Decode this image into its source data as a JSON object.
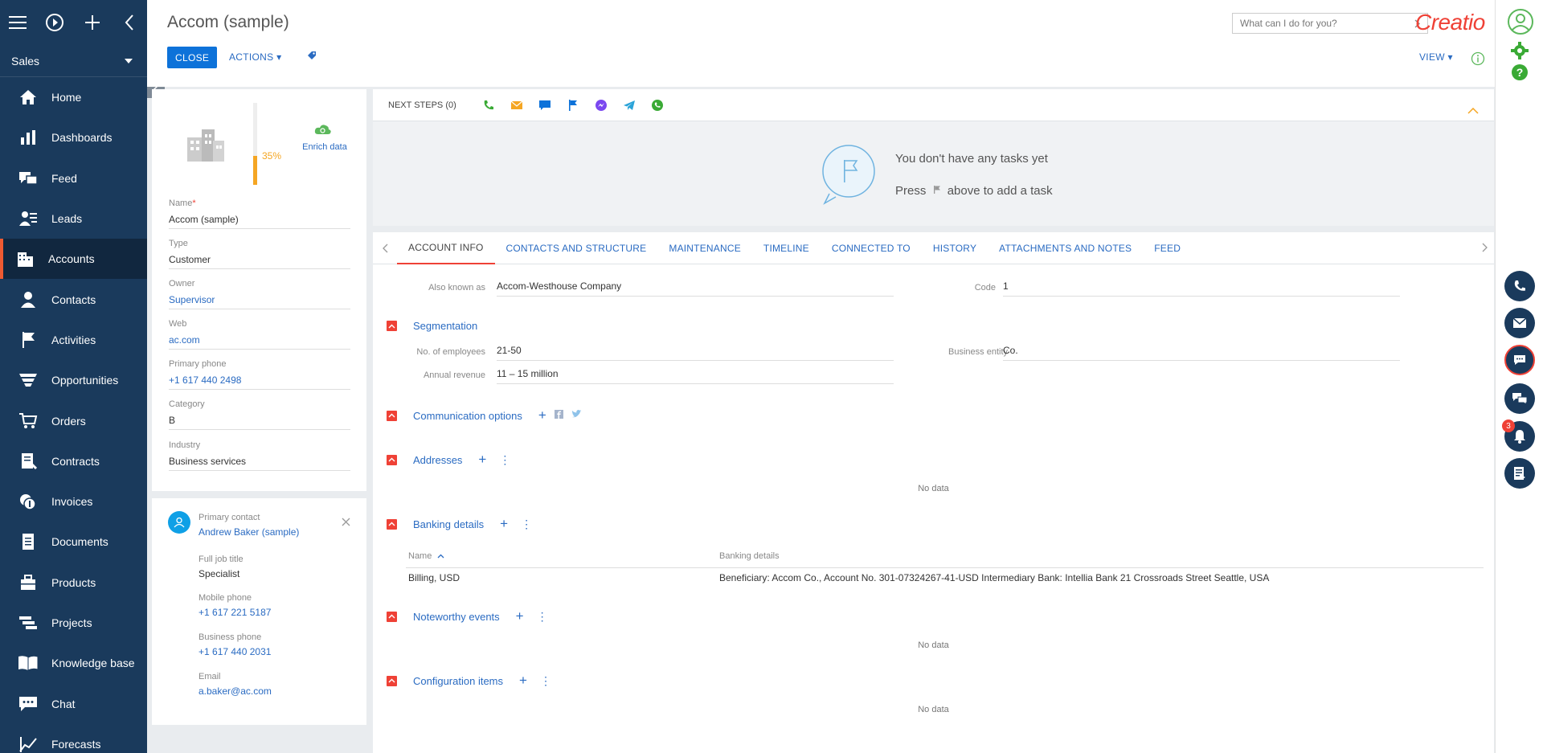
{
  "sidebar": {
    "section": "Sales",
    "items": [
      {
        "label": "Home",
        "icon": "home-icon"
      },
      {
        "label": "Dashboards",
        "icon": "dashboards-icon"
      },
      {
        "label": "Feed",
        "icon": "feed-icon"
      },
      {
        "label": "Leads",
        "icon": "leads-icon"
      },
      {
        "label": "Accounts",
        "icon": "accounts-icon"
      },
      {
        "label": "Contacts",
        "icon": "contacts-icon"
      },
      {
        "label": "Activities",
        "icon": "flag-icon"
      },
      {
        "label": "Opportunities",
        "icon": "opportunities-icon"
      },
      {
        "label": "Orders",
        "icon": "cart-icon"
      },
      {
        "label": "Contracts",
        "icon": "contracts-icon"
      },
      {
        "label": "Invoices",
        "icon": "invoices-icon"
      },
      {
        "label": "Documents",
        "icon": "documents-icon"
      },
      {
        "label": "Products",
        "icon": "products-icon"
      },
      {
        "label": "Projects",
        "icon": "projects-icon"
      },
      {
        "label": "Knowledge base",
        "icon": "book-icon"
      },
      {
        "label": "Chat",
        "icon": "chat-icon"
      },
      {
        "label": "Forecasts",
        "icon": "forecasts-icon"
      }
    ],
    "active": "Accounts"
  },
  "header": {
    "title": "Accom (sample)",
    "close_label": "CLOSE",
    "actions_label": "ACTIONS",
    "search_placeholder": "What can I do for you?",
    "logo": "Creatio",
    "view_label": "VIEW"
  },
  "profile": {
    "completeness": "35%",
    "completeness_value": 35,
    "enrich_label": "Enrich data",
    "fields": [
      {
        "label": "Name",
        "value": "Accom (sample)",
        "required": true,
        "link": false
      },
      {
        "label": "Type",
        "value": "Customer",
        "link": false
      },
      {
        "label": "Owner",
        "value": "Supervisor",
        "link": true
      },
      {
        "label": "Web",
        "value": "ac.com",
        "link": true
      },
      {
        "label": "Primary phone",
        "value": "+1 617 440 2498",
        "link": true
      },
      {
        "label": "Category",
        "value": "B",
        "link": false
      },
      {
        "label": "Industry",
        "value": "Business services",
        "link": false
      }
    ]
  },
  "contact": {
    "primary_label": "Primary contact",
    "primary_name": "Andrew Baker (sample)",
    "fields": [
      {
        "label": "Full job title",
        "value": "Specialist",
        "link": false
      },
      {
        "label": "Mobile phone",
        "value": "+1 617 221 5187",
        "link": true
      },
      {
        "label": "Business phone",
        "value": "+1 617 440 2031",
        "link": true
      },
      {
        "label": "Email",
        "value": "a.baker@ac.com",
        "link": true
      }
    ]
  },
  "next_steps": {
    "label": "NEXT STEPS (0)",
    "empty_line1": "You don't have any tasks yet",
    "empty_press": "Press",
    "empty_rest": "above to add a task"
  },
  "tabs": [
    "ACCOUNT INFO",
    "CONTACTS AND STRUCTURE",
    "MAINTENANCE",
    "TIMELINE",
    "CONNECTED TO",
    "HISTORY",
    "ATTACHMENTS AND NOTES",
    "FEED"
  ],
  "account_info": {
    "also_known_as_label": "Also known as",
    "also_known_as": "Accom-Westhouse Company",
    "code_label": "Code",
    "code": "1",
    "segmentation": "Segmentation",
    "employees_label": "No. of employees",
    "employees": "21-50",
    "business_entity_label": "Business entity",
    "business_entity": "Co.",
    "revenue_label": "Annual revenue",
    "revenue": "11 – 15 million",
    "communication": "Communication options",
    "addresses": "Addresses",
    "no_data": "No data",
    "banking": "Banking details",
    "bank_col_name": "Name",
    "bank_col_details": "Banking details",
    "bank_row_name": "Billing, USD",
    "bank_row_details": "Beneficiary: Accom Co., Account No. 301-07324267-41-USD Intermediary Bank: Intellia Bank 21 Crossroads Street Seattle, USA",
    "noteworthy": "Noteworthy events",
    "config_items": "Configuration items"
  },
  "right_rail": {
    "notification_count": "3"
  },
  "colors": {
    "sidebar": "#1a3a5c",
    "accent": "#ef4136",
    "primary": "#0d72d9",
    "link": "#2a6bc2"
  }
}
